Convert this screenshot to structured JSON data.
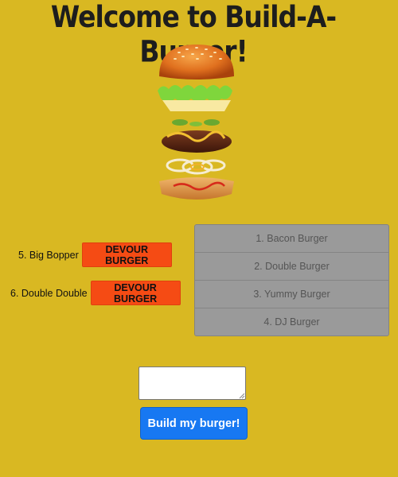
{
  "header": {
    "title": "Welcome to Build-A-Burger!"
  },
  "hero_image": {
    "icon": "burger-illustration"
  },
  "eaten_burgers": [
    {
      "label": "5. Big Bopper",
      "button_label": "DEVOUR BURGER"
    },
    {
      "label": "6. Double Double",
      "button_label": "DEVOUR BURGER"
    }
  ],
  "burger_list": [
    {
      "label": "1. Bacon Burger"
    },
    {
      "label": "2. Double Burger"
    },
    {
      "label": "3. Yummy Burger"
    },
    {
      "label": "4. DJ Burger"
    }
  ],
  "form": {
    "input_value": "",
    "submit_label": "Build my burger!"
  },
  "colors": {
    "background": "#d9b822",
    "devour_button": "#f54b14",
    "build_button": "#1778f2",
    "list_background": "#9a9a9a"
  }
}
